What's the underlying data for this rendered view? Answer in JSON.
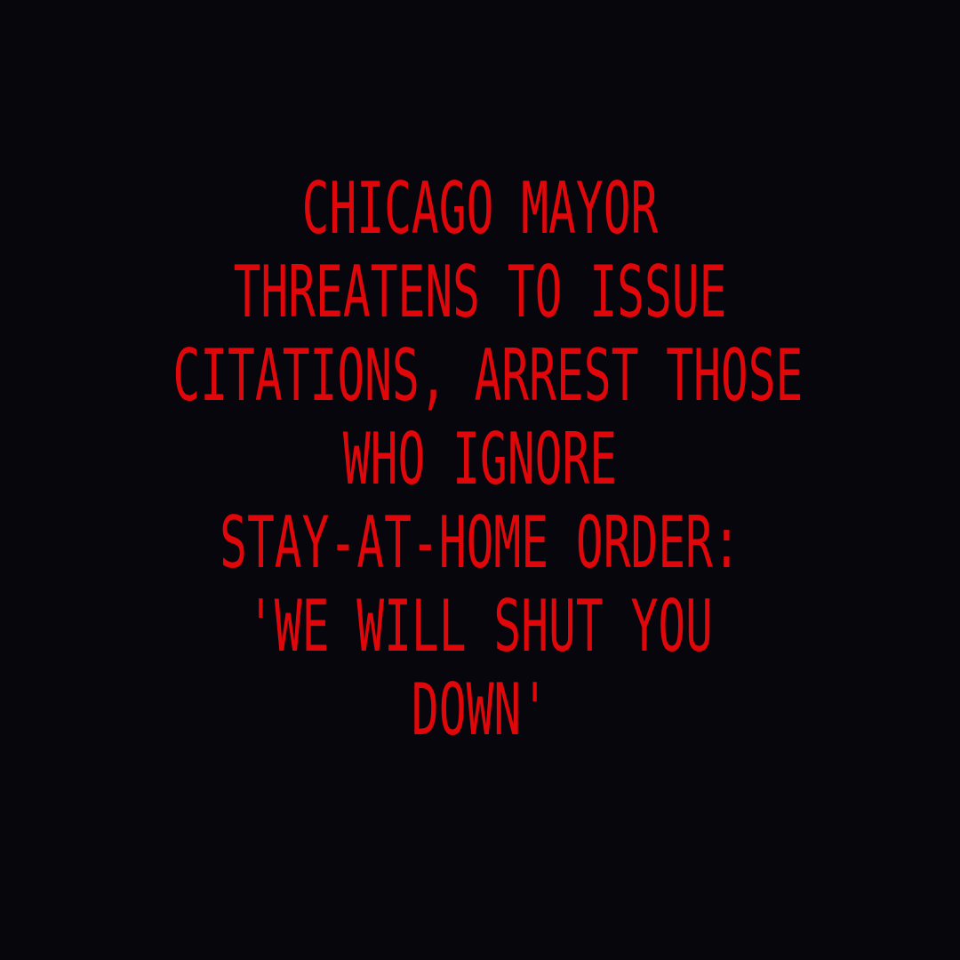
{
  "colors": {
    "background": "#07060c",
    "text": "#e0070b"
  },
  "headline": {
    "lines": [
      "CHICAGO MAYOR",
      "THREATENS TO ISSUE",
      "CITATIONS, ARREST THOSE",
      "WHO IGNORE",
      "STAY-AT-HOME ORDER:",
      "'WE WILL SHUT YOU",
      "DOWN'"
    ]
  }
}
